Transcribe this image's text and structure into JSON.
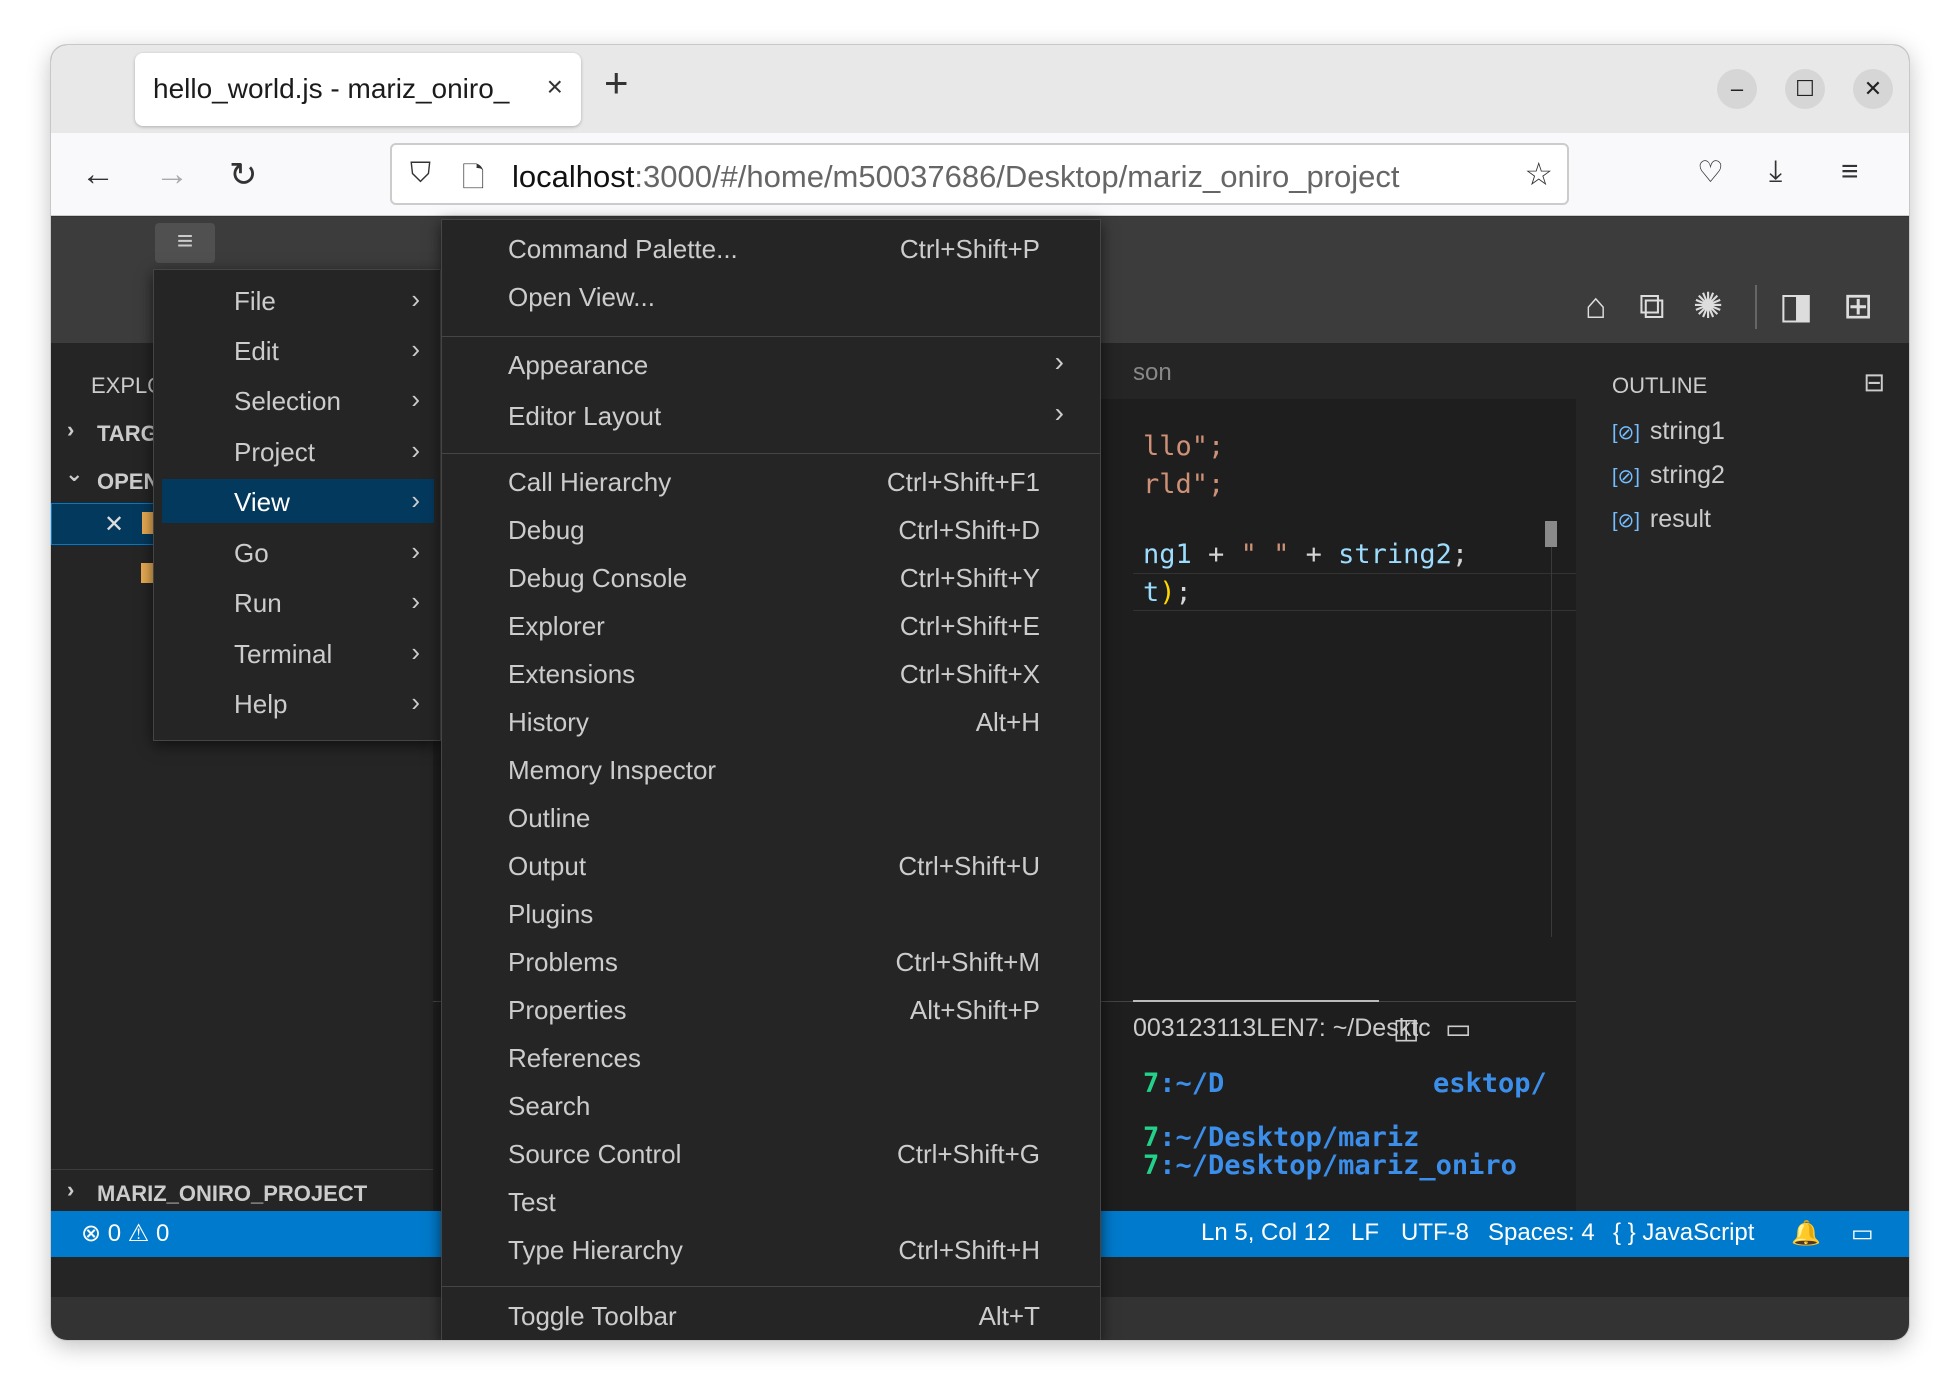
{
  "browser": {
    "tab_title": "hello_world.js - mariz_oniro_",
    "tab_close": "×",
    "new_tab": "+",
    "url_host": "localhost",
    "url_rest": ":3000/#/home/m50037686/Desktop/mariz_oniro_project",
    "window_controls": {
      "minimize": "–",
      "maximize": "☐",
      "close": "✕"
    }
  },
  "sidebar": {
    "explorer_label": "EXPLO",
    "section_target": "TARG",
    "section_open": "OPEN",
    "project_label": "MARIZ_ONIRO_PROJECT"
  },
  "editor": {
    "tab_fragment": "son",
    "lines": [
      {
        "text": "llo\";",
        "color": "#ce9178"
      },
      {
        "text": "rld\";",
        "color": "#ce9178"
      },
      {
        "text": "ng1 + \" \" + string2;",
        "color": "#9cdcfe"
      },
      {
        "text": "t);",
        "color": "#9cdcfe"
      }
    ]
  },
  "terminal": {
    "title": "003123113LEN7: ~/Desktc",
    "lines": [
      {
        "prefix": "7",
        "path": ":~/D",
        "suffix": "esktop/"
      },
      {
        "prefix": "7",
        "path": ":~/Desktop/mariz",
        "suffix": ""
      },
      {
        "prefix": "7",
        "path": ":~/Desktop/mariz_oniro",
        "suffix": ""
      }
    ]
  },
  "outline": {
    "title": "OUTLINE",
    "items": [
      "string1",
      "string2",
      "result"
    ]
  },
  "statusbar": {
    "errors": "0",
    "warnings": "0",
    "position": "Ln 5, Col 12",
    "eol": "LF",
    "encoding": "UTF-8",
    "spaces": "Spaces: 4",
    "language": "JavaScript"
  },
  "main_menu": {
    "items": [
      "File",
      "Edit",
      "Selection",
      "Project",
      "View",
      "Go",
      "Run",
      "Terminal",
      "Help"
    ],
    "active": "View"
  },
  "view_menu": {
    "group1": [
      {
        "label": "Command Palette...",
        "key": "Ctrl+Shift+P"
      },
      {
        "label": "Open View...",
        "key": ""
      }
    ],
    "group2": [
      {
        "label": "Appearance"
      },
      {
        "label": "Editor Layout"
      }
    ],
    "group3": [
      {
        "label": "Call Hierarchy",
        "key": "Ctrl+Shift+F1"
      },
      {
        "label": "Debug",
        "key": "Ctrl+Shift+D"
      },
      {
        "label": "Debug Console",
        "key": "Ctrl+Shift+Y"
      },
      {
        "label": "Explorer",
        "key": "Ctrl+Shift+E"
      },
      {
        "label": "Extensions",
        "key": "Ctrl+Shift+X"
      },
      {
        "label": "History",
        "key": "Alt+H"
      },
      {
        "label": "Memory Inspector",
        "key": ""
      },
      {
        "label": "Outline",
        "key": ""
      },
      {
        "label": "Output",
        "key": "Ctrl+Shift+U"
      },
      {
        "label": "Plugins",
        "key": ""
      },
      {
        "label": "Problems",
        "key": "Ctrl+Shift+M"
      },
      {
        "label": "Properties",
        "key": "Alt+Shift+P"
      },
      {
        "label": "References",
        "key": ""
      },
      {
        "label": "Search",
        "key": ""
      },
      {
        "label": "Source Control",
        "key": "Ctrl+Shift+G"
      },
      {
        "label": "Test",
        "key": ""
      },
      {
        "label": "Type Hierarchy",
        "key": "Ctrl+Shift+H"
      }
    ],
    "group4": [
      {
        "label": "Toggle Toolbar",
        "key": "Alt+T"
      }
    ]
  }
}
